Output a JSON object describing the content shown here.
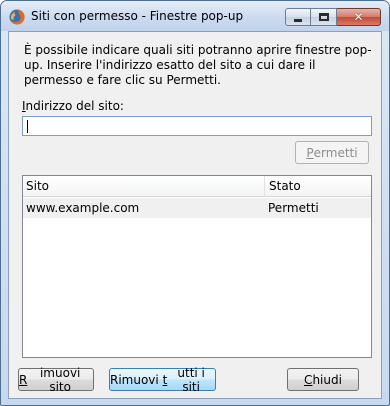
{
  "window": {
    "title": "Siti con permesso - Finestre pop-up",
    "icon": "firefox-icon"
  },
  "caption_buttons": {
    "minimize": "minimize-icon",
    "maximize": "maximize-icon",
    "close": "✕"
  },
  "description": "È possibile indicare quali siti potranno aprire finestre pop-up. Inserire l'indirizzo esatto del sito a cui dare il permesso e fare clic su Permetti.",
  "site_field": {
    "label_accel": "I",
    "label_rest": "ndirizzo del sito:",
    "value": "",
    "placeholder": ""
  },
  "permit_button": {
    "label_accel": "P",
    "label_rest": "ermetti",
    "enabled": false
  },
  "table": {
    "columns": [
      "Sito",
      "Stato"
    ],
    "rows": [
      {
        "site": "www.example.com",
        "state": "Permetti"
      }
    ]
  },
  "buttons": {
    "remove_accel": "R",
    "remove_rest": "imuovi sito",
    "remove_all_pre": "Rimuovi ",
    "remove_all_accel": "t",
    "remove_all_rest": "utti i siti",
    "close_accel": "C",
    "close_rest": "hiudi"
  }
}
